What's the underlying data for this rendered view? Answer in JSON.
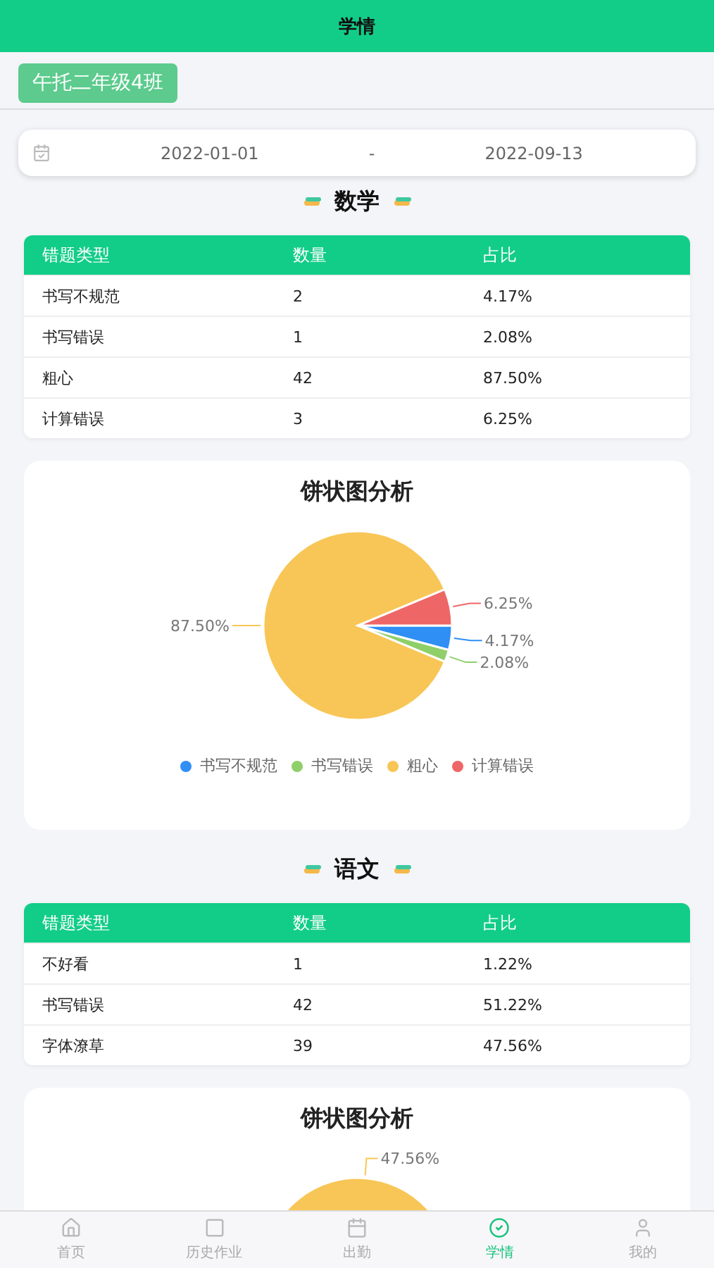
{
  "header": {
    "title": "学情"
  },
  "class_tag": "午托二年级4班",
  "date_range": {
    "start": "2022-01-01",
    "separator": "-",
    "end": "2022-09-13"
  },
  "subjects": [
    {
      "title": "数学",
      "table": {
        "columns": [
          "错题类型",
          "数量",
          "占比"
        ],
        "rows": [
          [
            "书写不规范",
            "2",
            "4.17%"
          ],
          [
            "书写错误",
            "1",
            "2.08%"
          ],
          [
            "粗心",
            "42",
            "87.50%"
          ],
          [
            "计算错误",
            "3",
            "6.25%"
          ]
        ]
      },
      "chart": {
        "title": "饼状图分析",
        "chart_data": {
          "type": "pie",
          "categories": [
            "书写不规范",
            "书写错误",
            "粗心",
            "计算错误"
          ],
          "values": [
            4.17,
            2.08,
            87.5,
            6.25
          ],
          "colors": [
            "#2f8ff5",
            "#8fcf6a",
            "#f8c657",
            "#ee6666"
          ],
          "value_labels": [
            "4.17%",
            "2.08%",
            "87.50%",
            "6.25%"
          ]
        }
      }
    },
    {
      "title": "语文",
      "table": {
        "columns": [
          "错题类型",
          "数量",
          "占比"
        ],
        "rows": [
          [
            "不好看",
            "1",
            "1.22%"
          ],
          [
            "书写错误",
            "42",
            "51.22%"
          ],
          [
            "字体潦草",
            "39",
            "47.56%"
          ]
        ]
      },
      "chart": {
        "title": "饼状图分析",
        "chart_data": {
          "type": "pie",
          "values": [
            null,
            null,
            47.56
          ],
          "colors": [
            null,
            null,
            "#f8c657"
          ],
          "value_labels": [
            null,
            null,
            "47.56%"
          ]
        }
      }
    }
  ],
  "tab_bar": [
    {
      "label": "首页",
      "kind": "home",
      "selected": false
    },
    {
      "label": "历史作业",
      "kind": "square",
      "selected": false
    },
    {
      "label": "出勤",
      "kind": "calendar",
      "selected": false
    },
    {
      "label": "学情",
      "kind": "check",
      "selected": true
    },
    {
      "label": "我的",
      "kind": "user",
      "selected": false
    }
  ]
}
